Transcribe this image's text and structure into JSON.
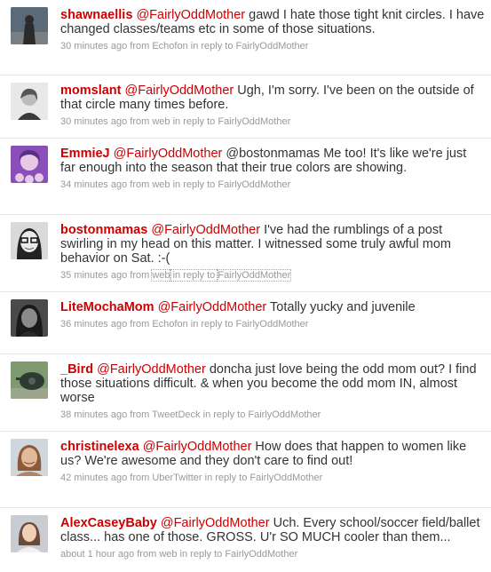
{
  "tweets": [
    {
      "username": "shawnaellis",
      "mention": "@FairlyOddMother",
      "text": " gawd I hate those tight knit circles. I have changed classes/teams etc in some of those situations.",
      "time": "30 minutes ago",
      "from_prefix": " from ",
      "source": "Echofon",
      "reply_prefix": " in reply to ",
      "reply_to": "FairlyOddMother",
      "avatar_icon": "avatar-silhouette-dark",
      "avatar_colors": [
        "#5a6a78",
        "#2c2a2a"
      ]
    },
    {
      "username": "momslant",
      "mention": "@FairlyOddMother",
      "text": " Ugh, I'm sorry. I've been on the outside of that circle many times before.",
      "time": "30 minutes ago",
      "from_prefix": " from ",
      "source": "web",
      "reply_prefix": " in reply to ",
      "reply_to": "FairlyOddMother",
      "avatar_icon": "avatar-portrait-bw",
      "avatar_colors": [
        "#e8e8e8",
        "#3a3a3a"
      ]
    },
    {
      "username": "EmmieJ",
      "mention": "@FairlyOddMother",
      "text": " @bostonmamas Me too! It's like we're just far enough into the season that their true colors are showing.",
      "time": "34 minutes ago",
      "from_prefix": " from ",
      "source": "web",
      "reply_prefix": " in reply to ",
      "reply_to": "FairlyOddMother",
      "avatar_icon": "avatar-portrait-purple",
      "avatar_colors": [
        "#8a4fb8",
        "#e7c9e6"
      ]
    },
    {
      "username": "bostonmamas",
      "mention": "@FairlyOddMother",
      "text": " I've had the rumblings of a post swirling in my head on this matter. I witnessed some truly awful mom behavior on Sat. :-(",
      "time": "35 minutes ago",
      "from_prefix": " from ",
      "source": "web",
      "reply_prefix": " in reply to ",
      "reply_to": "FairlyOddMother",
      "avatar_icon": "avatar-portrait-glasses",
      "avatar_colors": [
        "#d9d9d9",
        "#222222"
      ]
    },
    {
      "username": "LiteMochaMom",
      "mention": "@FairlyOddMother",
      "text": " Totally yucky and juvenile",
      "time": "36 minutes ago",
      "from_prefix": " from ",
      "source": "Echofon",
      "reply_prefix": " in reply to ",
      "reply_to": "FairlyOddMother",
      "avatar_icon": "avatar-portrait-dark",
      "avatar_colors": [
        "#4a4a4a",
        "#1a1a1a"
      ]
    },
    {
      "username": "_Bird",
      "mention": "@FairlyOddMother",
      "text": " doncha just love being the odd mom out? I find those situations difficult. & when you become the odd mom IN, almost worse",
      "time": "38 minutes ago",
      "from_prefix": " from ",
      "source": "TweetDeck",
      "reply_prefix": " in reply to ",
      "reply_to": "FairlyOddMother",
      "avatar_icon": "avatar-sculpture",
      "avatar_colors": [
        "#7f9a6e",
        "#2f3a34"
      ]
    },
    {
      "username": "christinelexa",
      "mention": "@FairlyOddMother",
      "text": " How does that happen to women like us? We're awesome and they don't care to find out!",
      "time": "42 minutes ago",
      "from_prefix": " from ",
      "source": "UberTwitter",
      "reply_prefix": " in reply to ",
      "reply_to": "FairlyOddMother",
      "avatar_icon": "avatar-portrait-smiling",
      "avatar_colors": [
        "#cfd6dc",
        "#b08462"
      ]
    },
    {
      "username": "AlexCaseyBaby",
      "mention": "@FairlyOddMother",
      "text": " Uch. Every school/soccer field/ballet class... has one of those. GROSS. U'r SO MUCH cooler than them...",
      "time": "about 1 hour ago",
      "from_prefix": " from ",
      "source": "web",
      "reply_prefix": " in reply to ",
      "reply_to": "FairlyOddMother",
      "avatar_icon": "avatar-portrait-bright",
      "avatar_colors": [
        "#c9ccd0",
        "#6a4a3a"
      ]
    }
  ]
}
